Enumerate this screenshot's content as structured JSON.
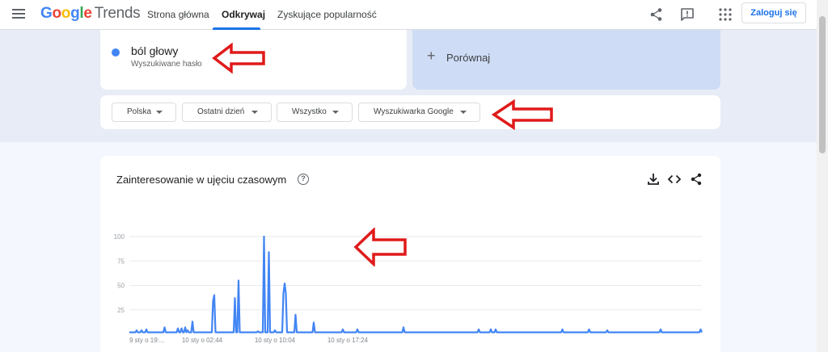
{
  "header": {
    "logo_google": "Google",
    "logo_trends": "Trends",
    "nav": [
      {
        "label": "Strona główna"
      },
      {
        "label": "Odkrywaj"
      },
      {
        "label": "Zyskujące popularność"
      }
    ],
    "login_label": "Zaloguj się",
    "icons": [
      "menu-icon",
      "share-icon",
      "feedback-icon",
      "apps-grid-icon"
    ]
  },
  "search": {
    "term": "ból głowy",
    "subtitle": "Wyszukiwane hasło",
    "term_color": "#4285f4"
  },
  "compare": {
    "plus": "+",
    "label": "Porównaj"
  },
  "filters": [
    {
      "label": "Polska"
    },
    {
      "label": "Ostatni dzień"
    },
    {
      "label": "Wszystko"
    },
    {
      "label": "Wyszukiwarka Google"
    }
  ],
  "chart_card": {
    "help_glyph": "?",
    "icons": [
      "download-icon",
      "embed-icon",
      "share-icon"
    ]
  },
  "colors": {
    "accent": "#1a73e8",
    "series": "#4285f4",
    "annotation_arrow": "#e01a1a"
  },
  "chart_data": {
    "type": "line",
    "title": "Zainteresowanie w ujęciu czasowym",
    "ylim": [
      0,
      100
    ],
    "yticks": [
      25,
      50,
      75,
      100
    ],
    "xtick_labels": [
      "9 sty o 19:...",
      "10 sty o 02:44",
      "10 sty o 10:04",
      "10 sty o 17:24"
    ],
    "xtick_positions": [
      0,
      60,
      120,
      180
    ],
    "grid": true,
    "series": [
      {
        "values": [
          2,
          2,
          2,
          2,
          2,
          2,
          4,
          2,
          2,
          2,
          4,
          2,
          2,
          2,
          5,
          2,
          2,
          2,
          2,
          2,
          2,
          2,
          2,
          2,
          2,
          2,
          2,
          2,
          2,
          7,
          2,
          2,
          2,
          2,
          2,
          2,
          2,
          2,
          2,
          2,
          6,
          2,
          2,
          6,
          2,
          2,
          7,
          2,
          4,
          2,
          2,
          2,
          13,
          2,
          2,
          2,
          2,
          2,
          2,
          2,
          2,
          2,
          2,
          2,
          2,
          2,
          2,
          2,
          2,
          34,
          40,
          2,
          2,
          2,
          2,
          2,
          2,
          2,
          2,
          2,
          2,
          2,
          2,
          2,
          2,
          2,
          2,
          37,
          2,
          2,
          55,
          2,
          2,
          2,
          2,
          2,
          2,
          2,
          2,
          2,
          2,
          2,
          2,
          2,
          2,
          2,
          3,
          2,
          2,
          2,
          2,
          100,
          2,
          2,
          2,
          84,
          2,
          2,
          2,
          2,
          4,
          2,
          2,
          2,
          2,
          2,
          2,
          42,
          52,
          42,
          2,
          2,
          2,
          2,
          2,
          2,
          2,
          20,
          2,
          2,
          2,
          2,
          2,
          2,
          2,
          2,
          2,
          2,
          2,
          2,
          2,
          2,
          12,
          2,
          2,
          2,
          2,
          2,
          2,
          2,
          2,
          2,
          2,
          2,
          2,
          2,
          2,
          2,
          2,
          2,
          2,
          2,
          2,
          2,
          2,
          2,
          5,
          2,
          2,
          2,
          2,
          2,
          2,
          2,
          2,
          2,
          2,
          2,
          5,
          2,
          2,
          2,
          2,
          2,
          2,
          2,
          2,
          2,
          2,
          2,
          2,
          2,
          2,
          2,
          2,
          2,
          2,
          2,
          2,
          2,
          2,
          2,
          2,
          2,
          2,
          2,
          2,
          2,
          2,
          2,
          2,
          2,
          2,
          2,
          2,
          2,
          7,
          2,
          2,
          2,
          2,
          2,
          2,
          2,
          2,
          2,
          2,
          2,
          2,
          2,
          2,
          2,
          2,
          2,
          2,
          2,
          2,
          2,
          2,
          2,
          2,
          2,
          2,
          2,
          2,
          2,
          2,
          2,
          2,
          2,
          2,
          2,
          2,
          2,
          2,
          2,
          2,
          2,
          2,
          2,
          2,
          2,
          2,
          2,
          2,
          2,
          2,
          2,
          2,
          2,
          2,
          2,
          2,
          2,
          2,
          2,
          2,
          2,
          5,
          2,
          2,
          2,
          2,
          2,
          2,
          2,
          2,
          2,
          5,
          2,
          2,
          2,
          5,
          2,
          2,
          2,
          2,
          2,
          2,
          2,
          2,
          2,
          2,
          2,
          2,
          2,
          2,
          2,
          2,
          2,
          2,
          2,
          2,
          2,
          2,
          2,
          2,
          2,
          2,
          2,
          2,
          2,
          2,
          2,
          2,
          2,
          2,
          2,
          2,
          2,
          2,
          2,
          2,
          2,
          2,
          2,
          2,
          2,
          2,
          2,
          2,
          2,
          2,
          2,
          2,
          2,
          2,
          5,
          2,
          2,
          2,
          2,
          2,
          2,
          2,
          2,
          2,
          2,
          2,
          2,
          2,
          2,
          2,
          2,
          2,
          2,
          2,
          2,
          2,
          5,
          2,
          2,
          2,
          2,
          2,
          2,
          2,
          2,
          2,
          2,
          2,
          2,
          2,
          2,
          4,
          2,
          2,
          2,
          2,
          2,
          2,
          2,
          2,
          2,
          2,
          2,
          2,
          2,
          2,
          2,
          2,
          2,
          2,
          2,
          2,
          2,
          2,
          2,
          2,
          2,
          2,
          2,
          2,
          2,
          2,
          2,
          2,
          2,
          2,
          2,
          2,
          2,
          2,
          2,
          2,
          2,
          2,
          2,
          5,
          2,
          2,
          2,
          2,
          2,
          2,
          2,
          2,
          2,
          2,
          2,
          2,
          2,
          2,
          2,
          2,
          2,
          2,
          2,
          2,
          2,
          2,
          2,
          2,
          2,
          2,
          2,
          2,
          2,
          2,
          2,
          2,
          5,
          2
        ]
      }
    ]
  }
}
